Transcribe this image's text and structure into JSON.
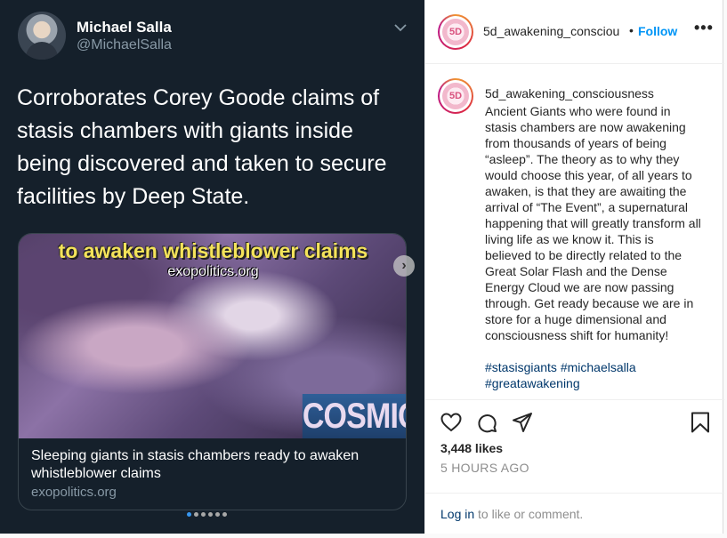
{
  "tweet": {
    "author_name": "Michael Salla",
    "author_handle": "@MichaelSalla",
    "text": "Corroborates Corey Goode claims of stasis chambers with giants inside being discovered and taken to secure facilities by Deep State.",
    "card": {
      "image_caption_top": "to awaken whistleblower claims",
      "image_caption_site": "exopolitics.org",
      "image_logo": "COSMIC",
      "title": "Sleeping giants in stasis chambers ready to awaken whistleblower claims",
      "domain": "exopolitics.org"
    },
    "colors": {
      "background": "#15202b",
      "secondary_text": "#8899a6"
    }
  },
  "carousel": {
    "total_slides": 6,
    "active_index": 0
  },
  "post": {
    "username": "5d_awakening_consciousness",
    "username_truncated": "5d_awakening_consciou",
    "avatar_text": "5D",
    "separator": "•",
    "follow_label": "Follow",
    "more_label": "•••",
    "caption": "Ancient Giants who were found in stasis chambers are now awakening from thousands of years of being “asleep”. The theory as to why they would choose this year, of all years to awaken, is that they are awaiting the arrival of “The Event”, a supernatural happening that will greatly transform all living life as we know it. This is believed to be directly related to the Great Solar Flash and the Dense Energy Cloud we are now passing through. Get ready because we are in store for a huge dimensional and consciousness shift for humanity!",
    "hashtags": "#stasisgiants #michaelsalla #greatawakening",
    "likes": "3,448 likes",
    "timestamp": "5 HOURS AGO",
    "login_link": "Log in",
    "login_suffix": " to like or comment.",
    "icons": [
      "heart-icon",
      "comment-icon",
      "share-icon",
      "bookmark-icon"
    ],
    "colors": {
      "link": "#0095f6",
      "hashtag": "#00376b",
      "muted": "#8e8e8e"
    }
  }
}
